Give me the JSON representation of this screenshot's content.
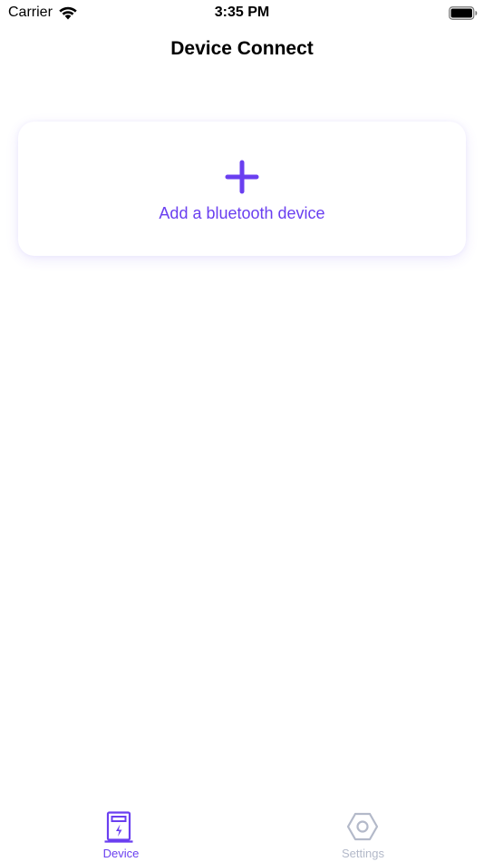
{
  "status_bar": {
    "carrier": "Carrier",
    "time": "3:35 PM",
    "wifi_icon": "wifi-icon",
    "battery_icon": "battery-icon"
  },
  "nav": {
    "title": "Device Connect"
  },
  "add_card": {
    "icon": "plus-icon",
    "label": "Add a bluetooth device"
  },
  "tab_bar": {
    "tabs": [
      {
        "label": "Device",
        "icon": "device-icon",
        "selected": true
      },
      {
        "label": "Settings",
        "icon": "settings-icon",
        "selected": false
      }
    ]
  },
  "colors": {
    "accent": "#6a3ff0",
    "inactive": "#b3b9c9",
    "background": "#ffffff"
  }
}
